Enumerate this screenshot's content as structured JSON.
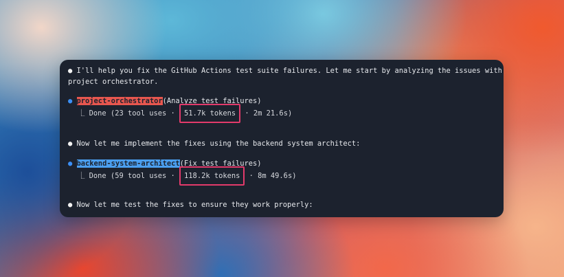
{
  "messages": [
    {
      "bullet": "●",
      "text_line1": "I'll help you fix the GitHub Actions test suite failures. Let me start by analyzing the issues with the",
      "text_line2": "project orchestrator."
    },
    {
      "bullet": "●",
      "agent": "project-orchestrator",
      "task": "(Analyze test failures)",
      "tree": "⎿",
      "status": "Done (23 tool uses ·",
      "tokens": "51.7k tokens",
      "duration": "· 2m 21.6s)"
    },
    {
      "bullet": "●",
      "text": "Now let me implement the fixes using the backend system architect:"
    },
    {
      "bullet": "●",
      "agent": "backend-system-architect",
      "task": "(Fix test failures)",
      "tree": "⎿",
      "status": "Done (59 tool uses ·",
      "tokens": "118.2k tokens",
      "duration": "· 8m 49.6s)"
    },
    {
      "bullet": "●",
      "text": "Now let me test the fixes to ensure they work properly:"
    }
  ],
  "colors": {
    "terminal_bg": "#1c222e",
    "agent1_highlight": "#e8574f",
    "agent2_highlight": "#4b9ff0",
    "token_box": "#e33a6b"
  }
}
